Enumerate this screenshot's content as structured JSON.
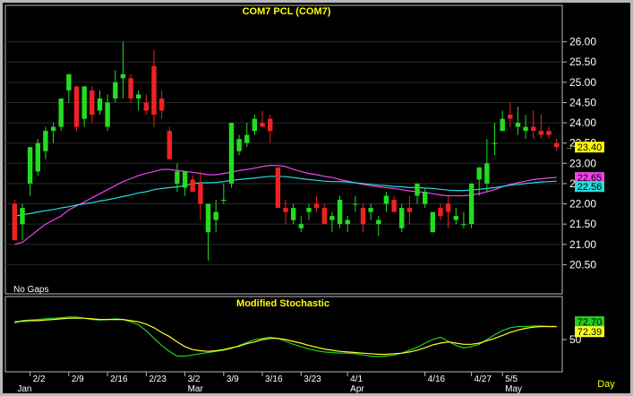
{
  "colors": {
    "background": "#000000",
    "frame": "#b8b8b8",
    "grid": "#2a2a2a",
    "up": "#22dd22",
    "down": "#ee2222",
    "title": "#ffff00",
    "text": "#ffffff",
    "ma_fast": "#ee44ee",
    "ma_slow": "#22dddd",
    "stoch_k": "#22cc22",
    "stoch_d": "#ffff22"
  },
  "chart_data": [
    {
      "type": "candlestick",
      "title": "COM7  PCL  (COM7)",
      "note": "No Gaps",
      "ylim": [
        20.0,
        26.5
      ],
      "yticks": [
        "26.00",
        "25.50",
        "25.00",
        "24.50",
        "24.00",
        "23.50",
        "23.00",
        "22.50",
        "22.00",
        "21.50",
        "21.00",
        "20.50"
      ],
      "ytick_values": [
        26.0,
        25.5,
        25.0,
        24.5,
        24.0,
        23.5,
        23.0,
        22.5,
        22.0,
        21.5,
        21.0,
        20.5
      ],
      "x_day_labels": [
        "2/2",
        "2/9",
        "2/16",
        "2/23",
        "3/2",
        "3/9",
        "3/16",
        "3/23",
        "4/1",
        "4/16",
        "4/27",
        "5/5"
      ],
      "x_day_label_index": [
        2,
        7,
        12,
        17,
        22,
        27,
        32,
        37,
        43,
        53,
        59,
        63
      ],
      "x_month_labels": [
        "Jan",
        "Mar",
        "Apr",
        "May"
      ],
      "x_month_label_index": [
        0,
        22,
        43,
        63
      ],
      "x_unit": "Day",
      "candles": [
        [
          22.0,
          22.1,
          21.8,
          21.1
        ],
        [
          21.5,
          22.0,
          21.1,
          21.9
        ],
        [
          22.5,
          23.4,
          22.2,
          23.4
        ],
        [
          22.8,
          23.6,
          22.7,
          23.5
        ],
        [
          23.3,
          23.9,
          23.1,
          23.8
        ],
        [
          23.8,
          24.0,
          23.5,
          23.9
        ],
        [
          23.9,
          24.6,
          23.8,
          24.6
        ],
        [
          24.8,
          25.2,
          24.5,
          25.2
        ],
        [
          24.9,
          24.9,
          23.8,
          23.9
        ],
        [
          24.1,
          24.9,
          23.9,
          24.9
        ],
        [
          24.8,
          24.9,
          24.0,
          24.2
        ],
        [
          24.3,
          24.8,
          24.2,
          24.6
        ],
        [
          23.9,
          24.7,
          23.8,
          24.5
        ],
        [
          24.6,
          25.3,
          24.5,
          25.0
        ],
        [
          25.1,
          26.0,
          24.6,
          25.2
        ],
        [
          25.1,
          25.2,
          24.5,
          24.6
        ],
        [
          24.6,
          24.8,
          24.3,
          24.7
        ],
        [
          24.5,
          24.7,
          24.2,
          24.3
        ],
        [
          25.4,
          25.8,
          23.9,
          24.2
        ],
        [
          24.6,
          24.8,
          24.1,
          24.3
        ],
        [
          23.8,
          23.9,
          23.1,
          23.1
        ],
        [
          22.5,
          23.0,
          22.3,
          22.8
        ],
        [
          22.4,
          22.8,
          22.2,
          22.8
        ],
        [
          22.6,
          22.7,
          22.3,
          22.3
        ],
        [
          22.5,
          22.8,
          21.6,
          22.0
        ],
        [
          21.3,
          22.0,
          20.6,
          22.0
        ],
        [
          21.6,
          22.1,
          21.3,
          21.8
        ],
        [
          22.1,
          22.5,
          22.0,
          22.1
        ],
        [
          22.5,
          24.0,
          22.4,
          24.0
        ],
        [
          23.3,
          23.7,
          23.2,
          23.6
        ],
        [
          23.5,
          24.0,
          23.4,
          23.7
        ],
        [
          23.8,
          24.2,
          23.7,
          24.1
        ],
        [
          24.0,
          24.3,
          23.9,
          23.9
        ],
        [
          24.1,
          24.2,
          23.5,
          23.8
        ],
        [
          22.9,
          22.9,
          21.9,
          21.9
        ],
        [
          21.9,
          22.1,
          21.5,
          21.8
        ],
        [
          21.6,
          22.0,
          21.5,
          21.9
        ],
        [
          21.4,
          21.7,
          21.3,
          21.5
        ],
        [
          21.8,
          22.0,
          21.6,
          21.9
        ],
        [
          22.0,
          22.2,
          21.8,
          21.9
        ],
        [
          21.9,
          22.0,
          21.5,
          21.5
        ],
        [
          21.6,
          21.8,
          21.3,
          21.7
        ],
        [
          21.5,
          22.2,
          21.4,
          22.1
        ],
        [
          21.5,
          21.7,
          21.3,
          21.6
        ],
        [
          22.0,
          22.2,
          21.8,
          22.0
        ],
        [
          21.9,
          22.0,
          21.3,
          21.5
        ],
        [
          21.8,
          22.0,
          21.6,
          21.9
        ],
        [
          21.5,
          21.7,
          21.2,
          21.6
        ],
        [
          22.0,
          22.3,
          21.8,
          22.2
        ],
        [
          22.1,
          22.2,
          21.8,
          21.8
        ],
        [
          21.4,
          22.0,
          21.3,
          21.9
        ],
        [
          21.9,
          22.2,
          21.5,
          21.8
        ],
        [
          22.2,
          22.5,
          22.0,
          22.5
        ],
        [
          22.0,
          22.4,
          21.9,
          22.3
        ],
        [
          21.3,
          21.8,
          21.3,
          21.8
        ],
        [
          21.9,
          22.0,
          21.6,
          21.7
        ],
        [
          22.0,
          22.2,
          21.4,
          21.8
        ],
        [
          21.6,
          21.9,
          21.5,
          21.7
        ],
        [
          21.5,
          21.8,
          21.4,
          21.5
        ],
        [
          21.5,
          22.5,
          21.4,
          22.5
        ],
        [
          22.6,
          22.9,
          22.2,
          22.9
        ],
        [
          22.5,
          23.6,
          22.3,
          23.0
        ],
        [
          23.5,
          24.0,
          23.2,
          23.5
        ],
        [
          23.8,
          24.3,
          23.8,
          24.1
        ],
        [
          24.2,
          24.5,
          23.9,
          24.1
        ],
        [
          23.9,
          24.4,
          23.7,
          24.0
        ],
        [
          23.8,
          24.2,
          23.6,
          23.9
        ],
        [
          23.9,
          24.3,
          23.6,
          23.8
        ],
        [
          23.8,
          24.2,
          23.6,
          23.7
        ],
        [
          23.8,
          23.9,
          23.6,
          23.7
        ],
        [
          23.5,
          23.6,
          23.3,
          23.4
        ]
      ],
      "series": [
        {
          "values": [
            21.0,
            21.05,
            21.2,
            21.35,
            21.5,
            21.6,
            21.7,
            21.85,
            21.95,
            22.05,
            22.15,
            22.25,
            22.35,
            22.45,
            22.55,
            22.62,
            22.7,
            22.75,
            22.8,
            22.85,
            22.85,
            22.82,
            22.8,
            22.78,
            22.75,
            22.72,
            22.72,
            22.75,
            22.78,
            22.82,
            22.85,
            22.88,
            22.92,
            22.95,
            22.95,
            22.92,
            22.85,
            22.8,
            22.75,
            22.72,
            22.68,
            22.65,
            22.6,
            22.56,
            22.52,
            22.48,
            22.45,
            22.42,
            22.4,
            22.38,
            22.35,
            22.32,
            22.3,
            22.28,
            22.25,
            22.22,
            22.2,
            22.2,
            22.2,
            22.22,
            22.25,
            22.3,
            22.35,
            22.42,
            22.48,
            22.52,
            22.56,
            22.6,
            22.62,
            22.64,
            22.65
          ]
        },
        {
          "values": [
            21.7,
            21.73,
            21.76,
            21.8,
            21.83,
            21.86,
            21.9,
            21.93,
            21.97,
            22.0,
            22.03,
            22.07,
            22.1,
            22.14,
            22.18,
            22.22,
            22.27,
            22.3,
            22.35,
            22.38,
            22.4,
            22.42,
            22.45,
            22.5,
            22.52,
            22.52,
            22.53,
            22.55,
            22.58,
            22.6,
            22.62,
            22.64,
            22.66,
            22.68,
            22.68,
            22.67,
            22.65,
            22.62,
            22.6,
            22.58,
            22.56,
            22.55,
            22.55,
            22.54,
            22.52,
            22.5,
            22.48,
            22.46,
            22.45,
            22.43,
            22.42,
            22.4,
            22.4,
            22.39,
            22.38,
            22.36,
            22.34,
            22.33,
            22.33,
            22.34,
            22.36,
            22.38,
            22.4,
            22.43,
            22.46,
            22.48,
            22.5,
            22.52,
            22.54,
            22.55,
            22.56
          ]
        }
      ],
      "last_price_label": "23.40",
      "ma_labels": [
        "22.65",
        "22.56"
      ]
    },
    {
      "type": "line",
      "title": "Modified  Stochastic",
      "ylim": [
        0,
        100
      ],
      "yticks": [
        "50"
      ],
      "ytick_values": [
        50
      ],
      "series": [
        {
          "values": [
            78,
            82,
            83,
            84,
            85,
            86,
            87,
            88,
            88,
            86,
            84,
            83,
            84,
            85,
            84,
            80,
            75,
            65,
            52,
            40,
            30,
            22,
            22,
            24,
            26,
            28,
            30,
            32,
            35,
            40,
            45,
            50,
            52,
            54,
            52,
            47,
            42,
            38,
            34,
            31,
            29,
            28,
            27,
            27,
            26,
            24,
            22,
            21,
            22,
            24,
            27,
            32,
            37,
            44,
            50,
            54,
            47,
            40,
            36,
            38,
            42,
            50,
            58,
            65,
            70,
            72,
            72,
            73,
            73,
            72,
            72
          ]
        },
        {
          "values": [
            80,
            81,
            82,
            82,
            83,
            84,
            85,
            86,
            86,
            86,
            85,
            84,
            84,
            84,
            84,
            82,
            80,
            76,
            70,
            62,
            55,
            46,
            38,
            33,
            31,
            30,
            31,
            33,
            36,
            39,
            43,
            46,
            50,
            52,
            52,
            50,
            47,
            44,
            40,
            37,
            34,
            32,
            30,
            29,
            28,
            27,
            26,
            25,
            25,
            26,
            27,
            29,
            32,
            36,
            41,
            44,
            46,
            44,
            42,
            42,
            44,
            48,
            52,
            57,
            62,
            66,
            69,
            71,
            72,
            72,
            72
          ]
        }
      ],
      "k_label": "72.70",
      "d_label": "72.39"
    }
  ]
}
